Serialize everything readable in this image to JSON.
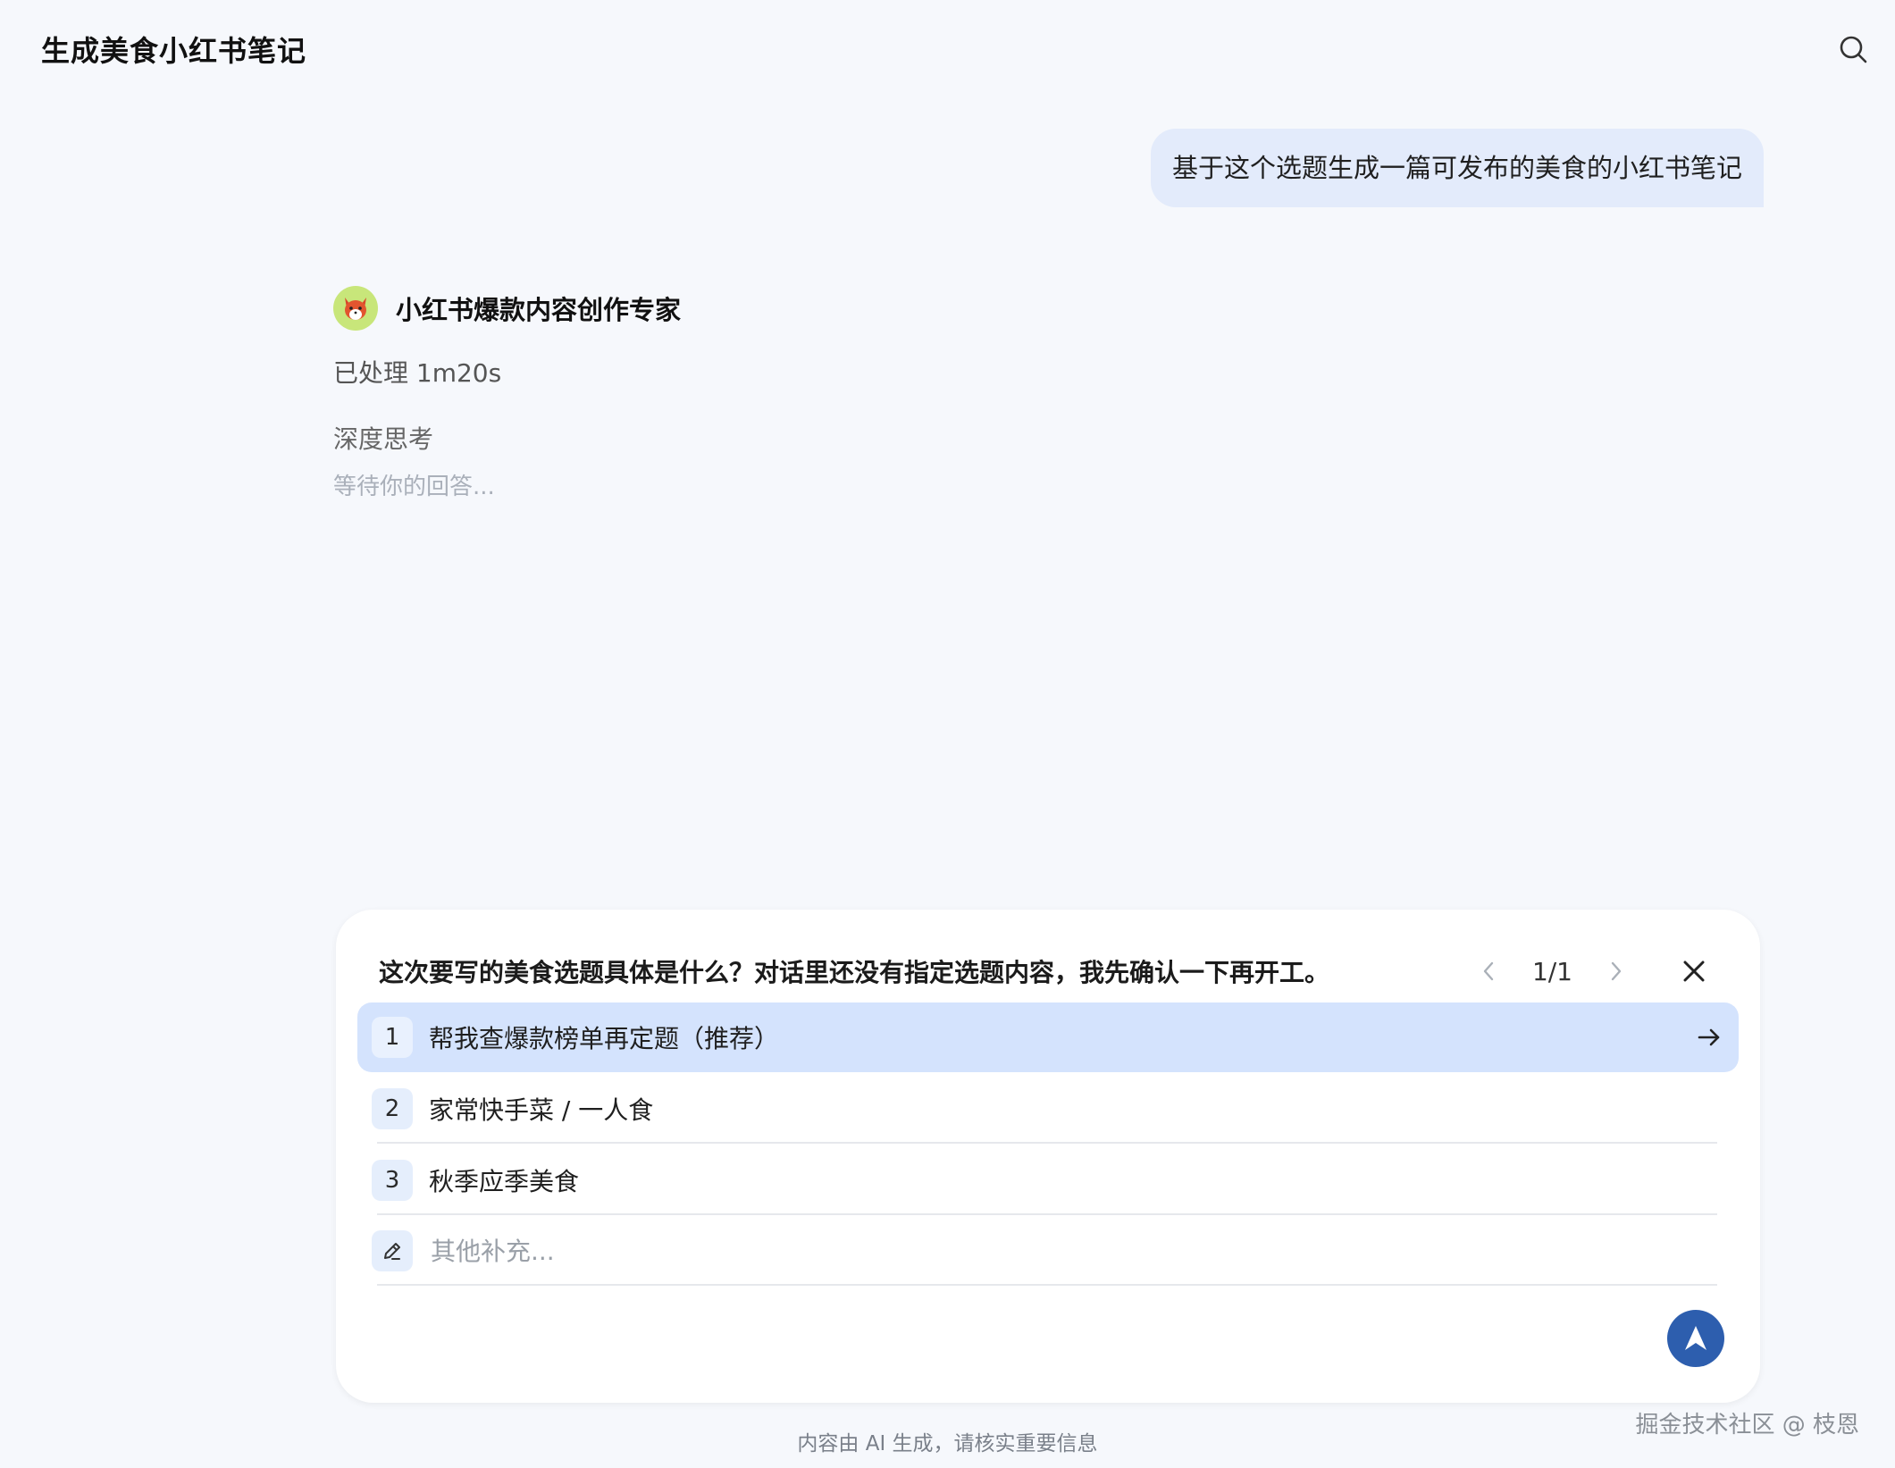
{
  "header": {
    "title": "生成美食小红书笔记",
    "search_icon": "search-icon"
  },
  "user_message": "基于这个选题生成一篇可发布的美食的小红书笔记",
  "agent": {
    "name": "小红书爆款内容创作专家",
    "processed": "已处理 1m20s",
    "thinking_label": "深度思考",
    "waiting_text": "等待你的回答..."
  },
  "question_card": {
    "question": "这次要写的美食选题具体是什么？对话里还没有指定选题内容，我先确认一下再开工。",
    "page_indicator": "1/1",
    "options": [
      {
        "number": "1",
        "label": "帮我查爆款榜单再定题（推荐）",
        "selected": true
      },
      {
        "number": "2",
        "label": "家常快手菜 / 一人食",
        "selected": false
      },
      {
        "number": "3",
        "label": "秋季应季美食",
        "selected": false
      }
    ],
    "other_placeholder": "其他补充..."
  },
  "footer": {
    "disclaimer": "内容由 AI 生成，请核实重要信息",
    "watermark": "掘金技术社区 @ 枝恩"
  },
  "colors": {
    "background": "#f6f8fc",
    "user_bubble": "#e3ebfb",
    "selected_option": "#d4e3fd",
    "send_button": "#2d5eae"
  }
}
